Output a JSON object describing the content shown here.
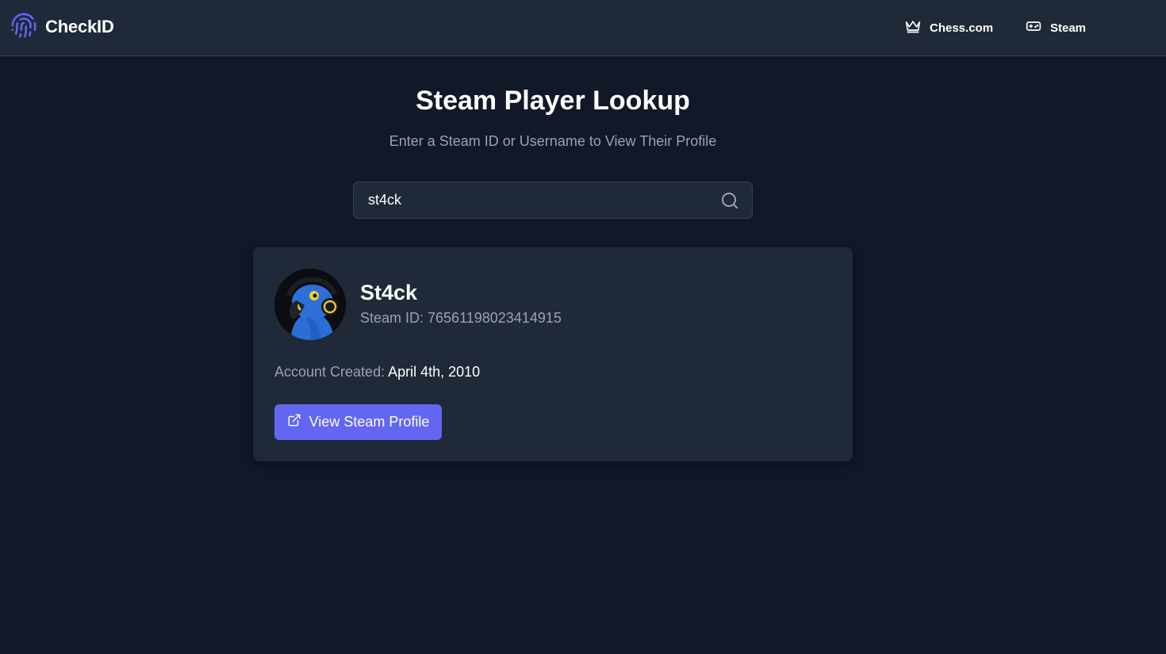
{
  "nav": {
    "brand": "CheckID",
    "links": [
      {
        "label": "Chess.com",
        "icon": "crown-icon"
      },
      {
        "label": "Steam",
        "icon": "gamepad-icon"
      }
    ]
  },
  "header": {
    "title": "Steam Player Lookup",
    "subtitle": "Enter a Steam ID or Username to View Their Profile"
  },
  "search": {
    "value": "st4ck",
    "placeholder": ""
  },
  "result": {
    "name": "St4ck",
    "steam_id_text": "Steam ID: 76561198023414915",
    "created_label": "Account Created:",
    "created_value": "April 4th, 2010",
    "button_label": "View Steam Profile"
  },
  "colors": {
    "background": "#111827",
    "surface": "#1f2937",
    "accent": "#6366f1",
    "muted_text": "#9ca3af"
  }
}
